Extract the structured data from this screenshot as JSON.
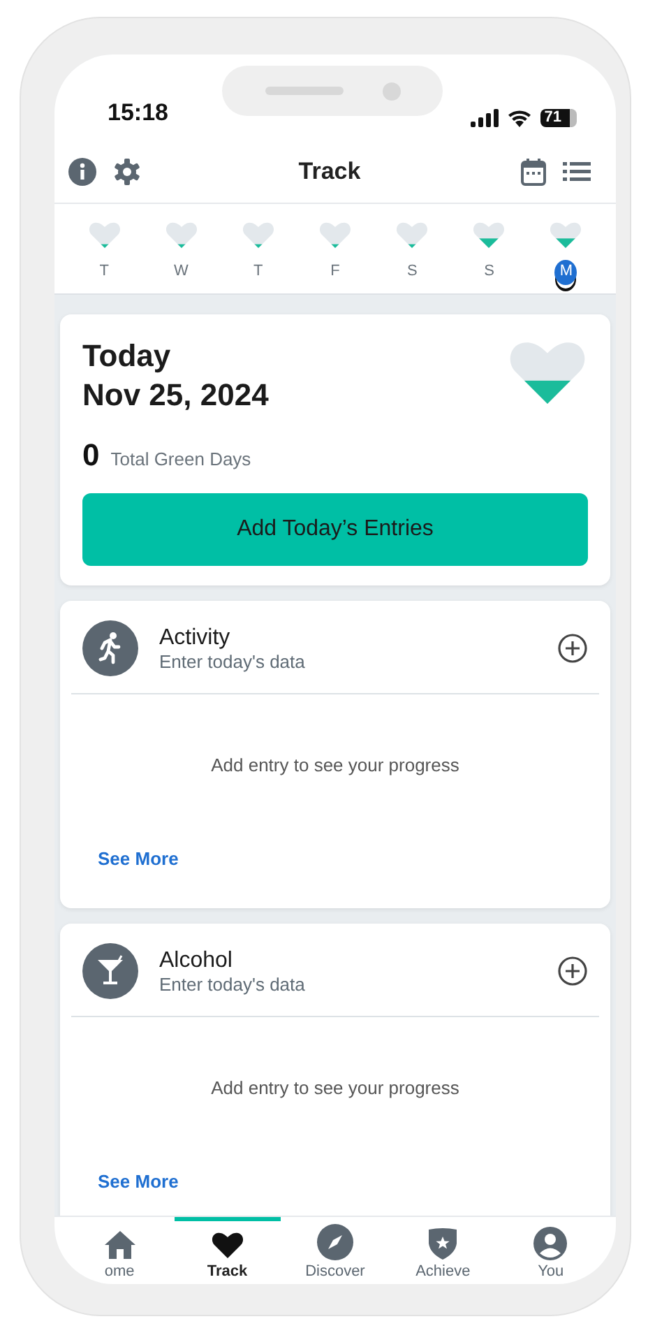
{
  "status_bar": {
    "time": "15:18",
    "battery": "71"
  },
  "header": {
    "title": "Track"
  },
  "week": [
    {
      "label": "T",
      "kind": "low",
      "selected": false
    },
    {
      "label": "W",
      "kind": "low",
      "selected": false
    },
    {
      "label": "T",
      "kind": "low",
      "selected": false
    },
    {
      "label": "F",
      "kind": "low",
      "selected": false
    },
    {
      "label": "S",
      "kind": "low",
      "selected": false
    },
    {
      "label": "S",
      "kind": "mid",
      "selected": false
    },
    {
      "label": "M",
      "kind": "mid",
      "selected": true
    }
  ],
  "today": {
    "label": "Today",
    "date": "Nov 25, 2024",
    "kind": "mid",
    "count": "0",
    "count_label": "Total Green Days",
    "button": "Add Today’s Entries"
  },
  "trackers": [
    {
      "kind": "activity",
      "title": "Activity",
      "subtitle": "Enter today's data",
      "empty": "Add entry to see your progress",
      "link": "See More"
    },
    {
      "kind": "alcohol",
      "title": "Alcohol",
      "subtitle": "Enter today's data",
      "empty": "Add entry to see your progress",
      "link": "See More"
    }
  ],
  "tab_bar": [
    {
      "kind": "home",
      "label": "ome",
      "selected": false
    },
    {
      "kind": "heart",
      "label": "Track",
      "selected": true
    },
    {
      "kind": "compass",
      "label": "Discover",
      "selected": false
    },
    {
      "kind": "shield",
      "label": "Achieve",
      "selected": false
    },
    {
      "kind": "person",
      "label": "You",
      "selected": false
    }
  ]
}
